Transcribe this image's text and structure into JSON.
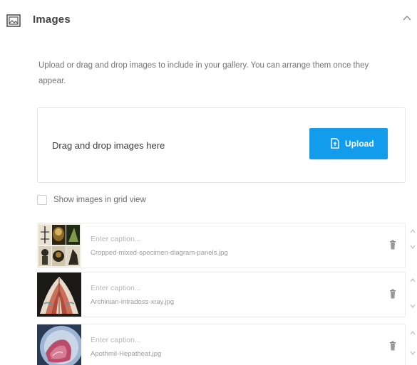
{
  "header": {
    "title": "Images",
    "icon": "image-icon",
    "toggle_icon": "chevron-up-icon"
  },
  "description": "Upload or drag and drop images to include in your gallery. You can arrange them once they appear.",
  "dropzone": {
    "text": "Drag and drop images here",
    "upload_label": "Upload",
    "upload_icon": "upload-file-icon"
  },
  "grid_view": {
    "label": "Show images in grid view",
    "checked": false
  },
  "images": [
    {
      "caption_placeholder": "Enter caption...",
      "caption_value": "",
      "file_name": "Cropped-mixed-specimen-diagram-panels.jpg"
    },
    {
      "caption_placeholder": "Enter caption...",
      "caption_value": "",
      "file_name": "Archinian-intradoss-xray.jpg"
    },
    {
      "caption_placeholder": "Enter caption...",
      "caption_value": "",
      "file_name": "Apothmil-Hepatheat.jpg"
    }
  ],
  "colors": {
    "accent": "#139bec",
    "border": "#e6e6e6"
  }
}
